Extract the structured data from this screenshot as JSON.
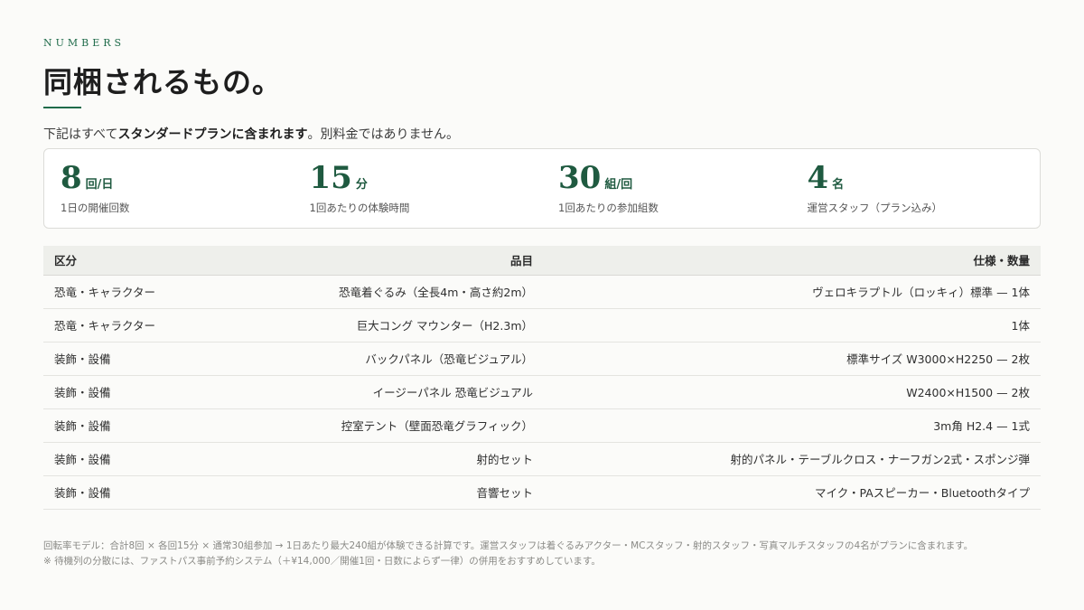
{
  "header": {
    "eyebrow": "NUMBERS",
    "title": "同梱されるもの。",
    "intro_before": "下記はすべて",
    "intro_bold": "スタンダードプランに含まれます",
    "intro_after": "。別料金ではありません。"
  },
  "stats": [
    {
      "value": "8",
      "unit": "回/日",
      "label": "1日の開催回数"
    },
    {
      "value": "15",
      "unit": "分",
      "label": "1回あたりの体験時間"
    },
    {
      "value": "30",
      "unit": "組/回",
      "label": "1回あたりの参加組数"
    },
    {
      "value": "4",
      "unit": "名",
      "label": "運営スタッフ（プラン込み）"
    }
  ],
  "table": {
    "headers": [
      "区分",
      "品目",
      "仕様・数量"
    ],
    "rows": [
      [
        "恐竜・キャラクター",
        "恐竜着ぐるみ（全長4m・高さ約2m）",
        "ヴェロキラプトル（ロッキィ）標準 — 1体"
      ],
      [
        "恐竜・キャラクター",
        "巨大コング マウンター（H2.3m）",
        "1体"
      ],
      [
        "装飾・設備",
        "バックパネル（恐竜ビジュアル）",
        "標準サイズ W3000×H2250 — 2枚"
      ],
      [
        "装飾・設備",
        "イージーパネル 恐竜ビジュアル",
        "W2400×H1500 — 2枚"
      ],
      [
        "装飾・設備",
        "控室テント（壁面恐竜グラフィック）",
        "3m角 H2.4 — 1式"
      ],
      [
        "装飾・設備",
        "射的セット",
        "射的パネル・テーブルクロス・ナーフガン2式・スポンジ弾"
      ],
      [
        "装飾・設備",
        "音響セット",
        "マイク・PAスピーカー・Bluetoothタイプ"
      ]
    ]
  },
  "notes": {
    "line1": "回転率モデル：合計8回 × 各回15分 × 通常30組参加 → 1日あたり最大240組が体験できる計算です。運営スタッフは着ぐるみアクター・MCスタッフ・射的スタッフ・写真マルチスタッフの4名がプランに含まれます。",
    "line2": "※ 待機列の分散には、ファストパス事前予約システム（＋¥14,000／開催1回・日数によらず一律）の併用をおすすめしています。"
  }
}
